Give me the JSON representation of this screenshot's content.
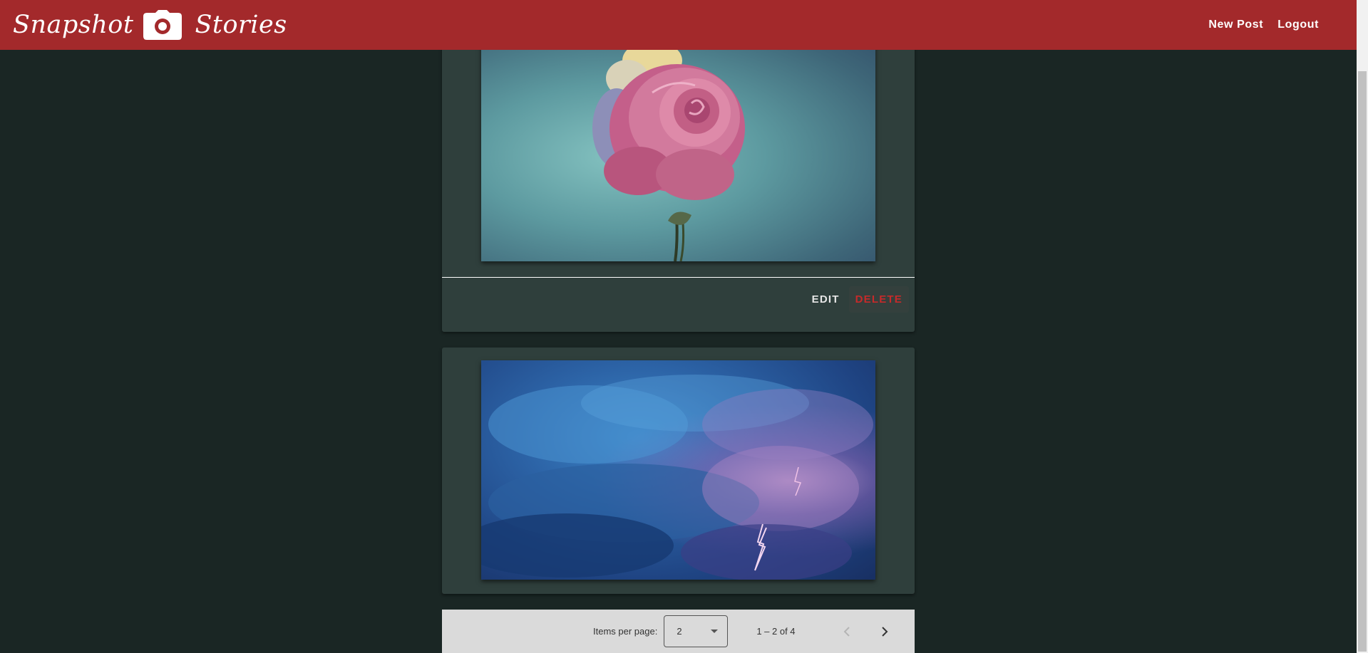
{
  "header": {
    "brand_left": "Snapshot",
    "brand_right": "Stories",
    "nav": [
      "New Post",
      "Logout"
    ],
    "bg_color": "#a3292b"
  },
  "posts": [
    {
      "image": "pink-rose-photo",
      "actions": {
        "edit": "EDIT",
        "delete": "DELETE"
      }
    },
    {
      "image": "lightning-storm-clouds-photo"
    }
  ],
  "paginator": {
    "items_per_page_label": "Items per page:",
    "items_per_page_value": "2",
    "range_label": "1 – 2 of 4"
  },
  "icons": {
    "camera": "camera-icon",
    "dropdown": "caret-down-icon",
    "prev": "chevron-left-icon",
    "next": "chevron-right-icon"
  }
}
